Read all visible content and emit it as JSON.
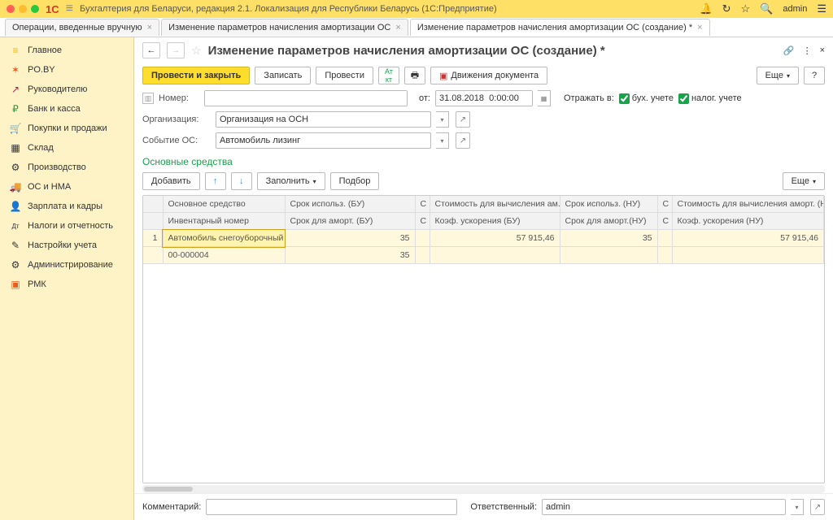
{
  "titlebar": {
    "logo": "1С",
    "title": "Бухгалтерия для Беларуси, редакция 2.1. Локализация для Республики Беларусь   (1С:Предприятие)",
    "user": "admin"
  },
  "tabs": [
    {
      "label": "Операции, введенные вручную"
    },
    {
      "label": "Изменение параметров начисления амортизации ОС"
    },
    {
      "label": "Изменение параметров начисления амортизации ОС (создание) *",
      "active": true
    }
  ],
  "sidebar": [
    {
      "icon": "≡",
      "label": "Главное",
      "color": "#f0b400"
    },
    {
      "icon": "✶",
      "label": "PO.BY",
      "color": "#e85d1f"
    },
    {
      "icon": "↗",
      "label": "Руководителю",
      "color": "#c2185b"
    },
    {
      "icon": "₽",
      "label": "Банк и касса",
      "color": "#16a34a"
    },
    {
      "icon": "🛒",
      "label": "Покупки и продажи",
      "color": "#555"
    },
    {
      "icon": "▦",
      "label": "Склад",
      "color": "#555"
    },
    {
      "icon": "⚙",
      "label": "Производство",
      "color": "#555"
    },
    {
      "icon": "🚚",
      "label": "ОС и НМА",
      "color": "#555"
    },
    {
      "icon": "👤",
      "label": "Зарплата и кадры",
      "color": "#555"
    },
    {
      "icon": "Дт",
      "label": "Налоги и отчетность",
      "color": "#555"
    },
    {
      "icon": "✎",
      "label": "Настройки учета",
      "color": "#555"
    },
    {
      "icon": "⚙",
      "label": "Администрирование",
      "color": "#555"
    },
    {
      "icon": "▣",
      "label": "РМК",
      "color": "#e85d1f"
    }
  ],
  "doc": {
    "title": "Изменение параметров начисления амортизации ОС (создание) *",
    "toolbar": {
      "postClose": "Провести и закрыть",
      "write": "Записать",
      "post": "Провести",
      "movements": "Движения документа",
      "more": "Еще"
    },
    "fields": {
      "number_label": "Номер:",
      "number_value": "",
      "date_label": "от:",
      "date_value": "31.08.2018  0:00:00",
      "reflect_label": "Отражать в:",
      "reflect_buh": "бух. учете",
      "reflect_nal": "налог. учете",
      "org_label": "Организация:",
      "org_value": "Организация на ОСН",
      "event_label": "Событие ОС:",
      "event_value": "Автомобиль лизинг"
    },
    "section": "Основные средства",
    "tbl_toolbar": {
      "add": "Добавить",
      "fill": "Заполнить",
      "pick": "Подбор",
      "more": "Еще"
    },
    "headers": {
      "r1c1": "Основное средство",
      "r1c2": "Срок использ. (БУ)",
      "r1c3": "С",
      "r1c4": "Стоимость для вычисления ам...",
      "r1c5": "Срок использ. (НУ)",
      "r1c6": "С",
      "r1c7": "Стоимость для вычисления аморт. (НУ)",
      "r2c1": "Инвентарный номер",
      "r2c2": "Срок для аморт. (БУ)",
      "r2c3": "С",
      "r2c4": "Коэф. ускорения (БУ)",
      "r2c5": "Срок для аморт.(НУ)",
      "r2c6": "С",
      "r2c7": "Коэф. ускорения (НУ)"
    },
    "rows": [
      {
        "n": "1",
        "os": "Автомобиль снегоуборочный",
        "srok_bu": "35",
        "cost_bu": "57 915,46",
        "srok_nu": "35",
        "cost_nu": "57 915,46",
        "inv": "00-000004",
        "srok_am_bu": "35"
      }
    ],
    "footer": {
      "comment_label": "Комментарий:",
      "comment_value": "",
      "resp_label": "Ответственный:",
      "resp_value": "admin"
    }
  }
}
